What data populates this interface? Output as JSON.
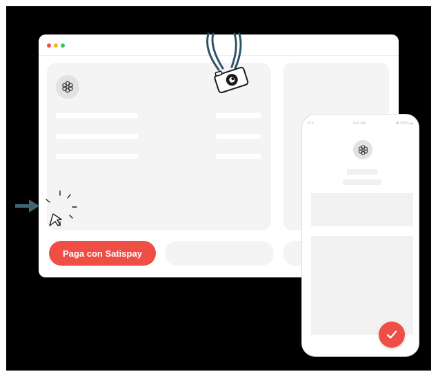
{
  "browser": {
    "window_controls": [
      "close",
      "minimize",
      "maximize"
    ]
  },
  "checkout": {
    "pay_button_label": "Paga con Satispay"
  },
  "phone": {
    "status_signal": "ıll ᯤ",
    "status_time": "9:41 AM",
    "status_battery": "✱ 100% ▬",
    "confirm_icon": "checkmark-icon"
  },
  "icons": {
    "brand_logo": "flower-logo-icon",
    "camera": "camera-icon",
    "arrow": "arrow-right-icon",
    "cursor": "pointer-cursor-icon"
  },
  "colors": {
    "accent": "#ee4e44",
    "background": "#000000",
    "card": "#f4f4f4",
    "camera_strap": "#2e5366"
  }
}
